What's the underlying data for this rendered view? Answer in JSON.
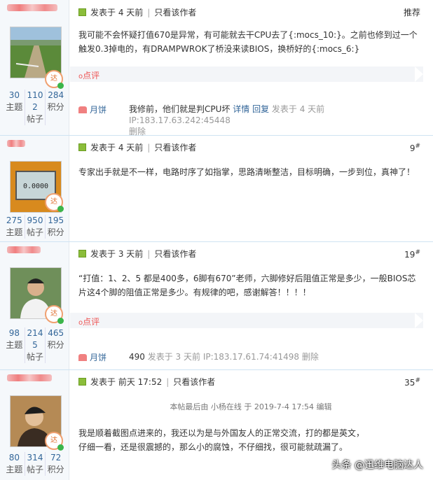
{
  "common": {
    "view_author": "只看该作者",
    "rate_label": "点评",
    "rate_prefix": "o",
    "edit_note": "本帖最后由 小杨在线 于 2019-7-4 17:54 编辑"
  },
  "posts": [
    {
      "username": "",
      "stats": [
        {
          "num": "30",
          "label": "主题"
        },
        {
          "num": "1102",
          "label": "帖子"
        },
        {
          "num": "284",
          "label": "积分"
        }
      ],
      "posted": "发表于 4 天前",
      "floor": "推荐",
      "floor_sup": "",
      "content": "我可能不会怀疑打值670是异常，有可能就去干CPU去了{:mocs_10:}。之前也修到过一个触发0.3掉电的，有DRAMPWROK了桥没来读BIOS，换桥好的{:mocs_6:}",
      "comment": {
        "user": "月饼",
        "text": "我修前，他们就是判CPU坏",
        "links": [
          "详情",
          "回复"
        ],
        "tail": "发表于 4 天前 IP:183.17.63.242:45448",
        "delete": "删除"
      }
    },
    {
      "username": "",
      "stats": [
        {
          "num": "275",
          "label": "主题"
        },
        {
          "num": "950",
          "label": "帖子"
        },
        {
          "num": "195",
          "label": "积分"
        }
      ],
      "posted": "发表于 4 天前",
      "floor": "9",
      "floor_sup": "#",
      "avatar_text": "0.0000",
      "content": "专家出手就是不一样，电路时序了如指掌，思路清晰整洁，目标明确，一步到位，真神了！"
    },
    {
      "username": "",
      "stats": [
        {
          "num": "98",
          "label": "主题"
        },
        {
          "num": "2145",
          "label": "帖子"
        },
        {
          "num": "465",
          "label": "积分"
        }
      ],
      "posted": "发表于 3 天前",
      "floor": "19",
      "floor_sup": "#",
      "content": "“打值：1、2、5 都是400多，6脚有670”老师，六脚修好后阻值正常是多少，一般BIOS芯片这4个脚的阻值正常是多少。有规律的吧，感谢解答！！！！",
      "comment": {
        "user": "月饼",
        "text": "490",
        "tail": "发表于 3 天前 IP:183.17.61.74:41498",
        "delete": "删除"
      }
    },
    {
      "username": "",
      "stats": [
        {
          "num": "80",
          "label": "主题"
        },
        {
          "num": "314",
          "label": "帖子"
        },
        {
          "num": "72",
          "label": "积分"
        }
      ],
      "posted": "发表于 前天 17:52",
      "floor": "35",
      "floor_sup": "#",
      "content_lines": [
        "我是顺着截图点进来的，我还以为是与外国友人的正常交流，打的都是英文，",
        "仔细一看，还是很震撼的，那么小的腐蚀，不仔细找，很可能就疏漏了。"
      ]
    }
  ],
  "watermark": "头条 @迅维电脑达人",
  "colors": {
    "link": "#336699",
    "rate": "#e55555",
    "sidebar_bg": "#f5f8fb"
  }
}
